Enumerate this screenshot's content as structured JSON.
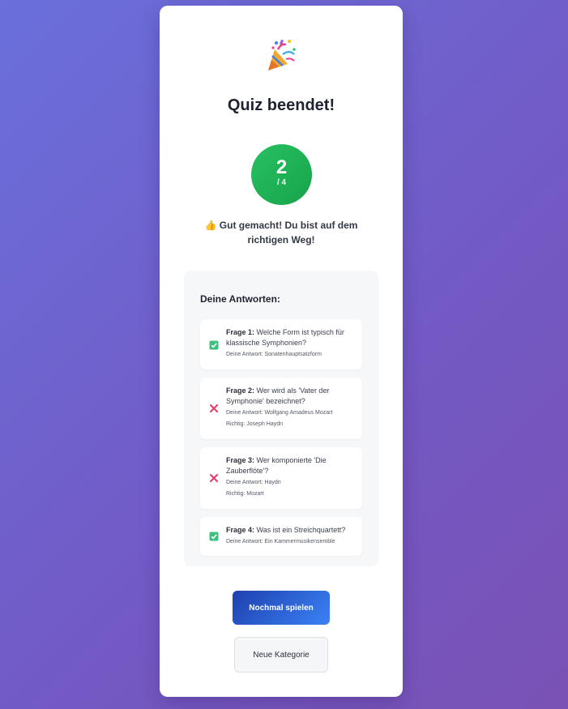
{
  "result": {
    "title": "Quiz beendet!",
    "score": "2",
    "total": "/ 4",
    "message": "👍 Gut gemacht! Du bist auf dem richtigen Weg!"
  },
  "review": {
    "title": "Deine Antworten:",
    "items": [
      {
        "label": "Frage 1:",
        "question": "Welche Form ist typisch für klassische Symphonien?",
        "answer": "Deine Antwort: Sonatenhauptsatzform",
        "correct": "",
        "status": "correct"
      },
      {
        "label": "Frage 2:",
        "question": "Wer wird als 'Vater der Symphonie' bezeichnet?",
        "answer": "Deine Antwort: Wolfgang Amadeus Mozart",
        "correct": "Richtig: Joseph Haydn",
        "status": "wrong"
      },
      {
        "label": "Frage 3:",
        "question": "Wer komponierte 'Die Zauberflöte'?",
        "answer": "Deine Antwort: Haydn",
        "correct": "Richtig: Mozart",
        "status": "wrong"
      },
      {
        "label": "Frage 4:",
        "question": "Was ist ein Streichquartett?",
        "answer": "Deine Antwort: Ein Kammermusikensemble",
        "correct": "",
        "status": "correct"
      }
    ]
  },
  "actions": {
    "play_again": "Nochmal spielen",
    "new_category": "Neue Kategorie"
  },
  "colors": {
    "correct": "#22b573",
    "wrong": "#e8416d",
    "score_bg": "#1fb155",
    "primary_btn": "#2d5fd6"
  },
  "icons": {
    "header": "party-popper-icon",
    "correct": "check-box-icon",
    "wrong": "cross-icon"
  }
}
